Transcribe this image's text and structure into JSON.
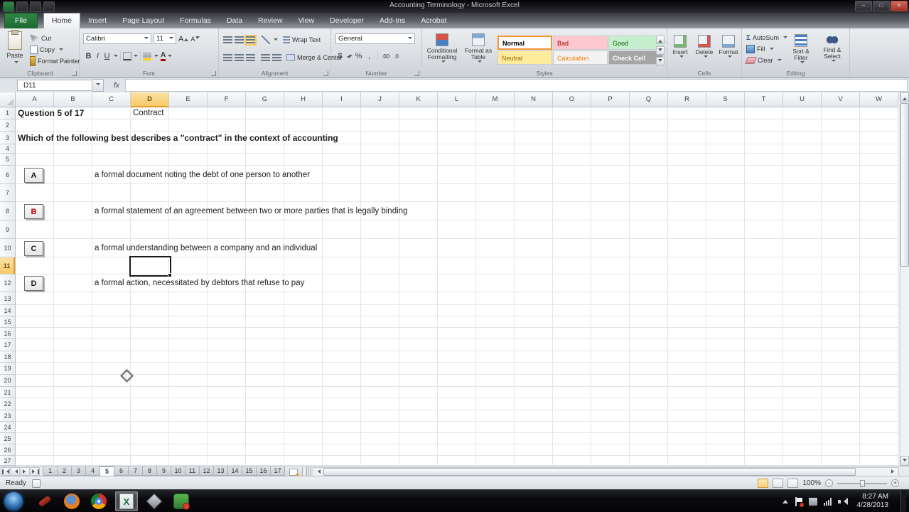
{
  "window": {
    "title": "Accounting Terminology - Microsoft Excel"
  },
  "ribbon_tabs": [
    {
      "label": "File",
      "file": true
    },
    {
      "label": "Home",
      "active": true
    },
    {
      "label": "Insert"
    },
    {
      "label": "Page Layout"
    },
    {
      "label": "Formulas"
    },
    {
      "label": "Data"
    },
    {
      "label": "Review"
    },
    {
      "label": "View"
    },
    {
      "label": "Developer"
    },
    {
      "label": "Add-Ins"
    },
    {
      "label": "Acrobat"
    }
  ],
  "ribbon": {
    "clipboard": {
      "label": "Clipboard",
      "paste": "Paste",
      "cut": "Cut",
      "copy": "Copy",
      "format_painter": "Format Painter"
    },
    "font": {
      "label": "Font",
      "family": "Calibri",
      "size": "11",
      "letter": "A",
      "bold": "B",
      "italic": "I",
      "underline": "U"
    },
    "alignment": {
      "label": "Alignment",
      "wrap_text": "Wrap Text",
      "merge_center": "Merge & Center"
    },
    "number": {
      "label": "Number",
      "format": "General",
      "currency": "$",
      "percent": "%",
      "comma": ",",
      "inc_decimal": ".00",
      "dec_decimal": ".0"
    },
    "styles": {
      "label": "Styles",
      "conditional_formatting": "Conditional Formatting",
      "format_as_table": "Format as Table",
      "gallery": [
        {
          "name": "Normal",
          "bg": "#ffffff",
          "fg": "#000000",
          "selected": true
        },
        {
          "name": "Bad",
          "bg": "#ffc7ce",
          "fg": "#9c0006"
        },
        {
          "name": "Good",
          "bg": "#c6efce",
          "fg": "#006100"
        },
        {
          "name": "Neutral",
          "bg": "#ffeb9c",
          "fg": "#9c6500"
        },
        {
          "name": "Calculation",
          "bg": "#f2f2f2",
          "fg": "#fa7d00"
        },
        {
          "name": "Check Cell",
          "bg": "#a5a5a5",
          "fg": "#ffffff"
        }
      ]
    },
    "cells": {
      "label": "Cells",
      "insert": "Insert",
      "delete": "Delete",
      "format": "Format"
    },
    "editing": {
      "label": "Editing",
      "sigma": "Σ",
      "autosum": "AutoSum",
      "fill": "Fill",
      "clear": "Clear",
      "sort_filter": "Sort & Filter",
      "find_select": "Find & Select"
    }
  },
  "formula_bar": {
    "name_box": "D11",
    "fx": "fx",
    "value": ""
  },
  "sheet": {
    "columns": [
      "A",
      "B",
      "C",
      "D",
      "E",
      "F",
      "G",
      "H",
      "I",
      "J",
      "K",
      "L",
      "M",
      "N",
      "O",
      "P",
      "Q",
      "R",
      "S",
      "T",
      "U",
      "V",
      "W"
    ],
    "row_count": 27,
    "selected_cell": {
      "ref": "D11",
      "col": "D",
      "row": 11
    },
    "cells": [
      {
        "ref": "A1",
        "col": "A",
        "row": 1,
        "text": "Question 5 of 17",
        "bold": true
      },
      {
        "ref": "D1",
        "col": "D",
        "row": 1,
        "text": "Contract",
        "bold": false
      },
      {
        "ref": "A3",
        "col": "A",
        "row": 3,
        "text": "Which of the following best describes a \"contract\" in the context of accounting",
        "bold": true
      }
    ],
    "answer_options": [
      {
        "letter": "A",
        "row": 6,
        "letter_color": "#1a1a1a",
        "text": "a formal document noting the debt of one person to another"
      },
      {
        "letter": "B",
        "row": 8,
        "letter_color": "#c00000",
        "text": "a formal statement of an agreement between two or more parties that is legally binding"
      },
      {
        "letter": "C",
        "row": 10,
        "letter_color": "#1a1a1a",
        "text": "a formal understanding between a company and an individual"
      },
      {
        "letter": "D",
        "row": 12,
        "letter_color": "#1a1a1a",
        "text": "a formal action, necessitated by debtors that refuse to pay"
      }
    ]
  },
  "sheet_tabs": {
    "tabs": [
      "1",
      "2",
      "3",
      "4",
      "5",
      "6",
      "7",
      "8",
      "9",
      "10",
      "11",
      "12",
      "13",
      "14",
      "15",
      "16",
      "17"
    ],
    "active": "5"
  },
  "status_bar": {
    "mode": "Ready",
    "zoom": "100%",
    "zoom_out": "-",
    "zoom_in": "+"
  },
  "taskbar": {
    "tray_time": "8:27 AM",
    "tray_date": "4/28/2013"
  }
}
